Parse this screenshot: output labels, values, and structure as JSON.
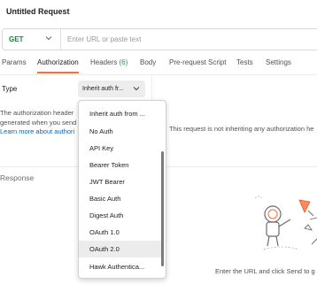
{
  "request": {
    "title": "Untitled Request",
    "method": "GET",
    "url_placeholder": "Enter URL or paste text"
  },
  "tabs": [
    {
      "label": "Params"
    },
    {
      "label": "Authorization",
      "active": true
    },
    {
      "label": "Headers",
      "count": "(6)"
    },
    {
      "label": "Body"
    },
    {
      "label": "Pre-request Script"
    },
    {
      "label": "Tests"
    },
    {
      "label": "Settings"
    }
  ],
  "auth": {
    "type_label": "Type",
    "selected": "Inherit auth fr...",
    "description_line1": "The authorization header",
    "description_line2": "generated when you send",
    "learn_more": "Learn more about authori",
    "not_inheriting": "This request is not inheriting any authorization he"
  },
  "dropdown": {
    "items": [
      "Inherit auth from ...",
      "No Auth",
      "API Key",
      "Bearer Token",
      "JWT Bearer",
      "Basic Auth",
      "Digest Auth",
      "OAuth 1.0",
      "OAuth 2.0",
      "Hawk Authentica..."
    ],
    "highlighted": "OAuth 2.0"
  },
  "response": {
    "label": "Response",
    "empty_hint": "Enter the URL and click Send to g"
  },
  "colors": {
    "accent": "#ff6c37",
    "method_get": "#0b8a3e",
    "link": "#0b63c4",
    "count": "#1a9c4a"
  },
  "icons": [
    "chevron-down-icon",
    "astronaut-illustration"
  ]
}
